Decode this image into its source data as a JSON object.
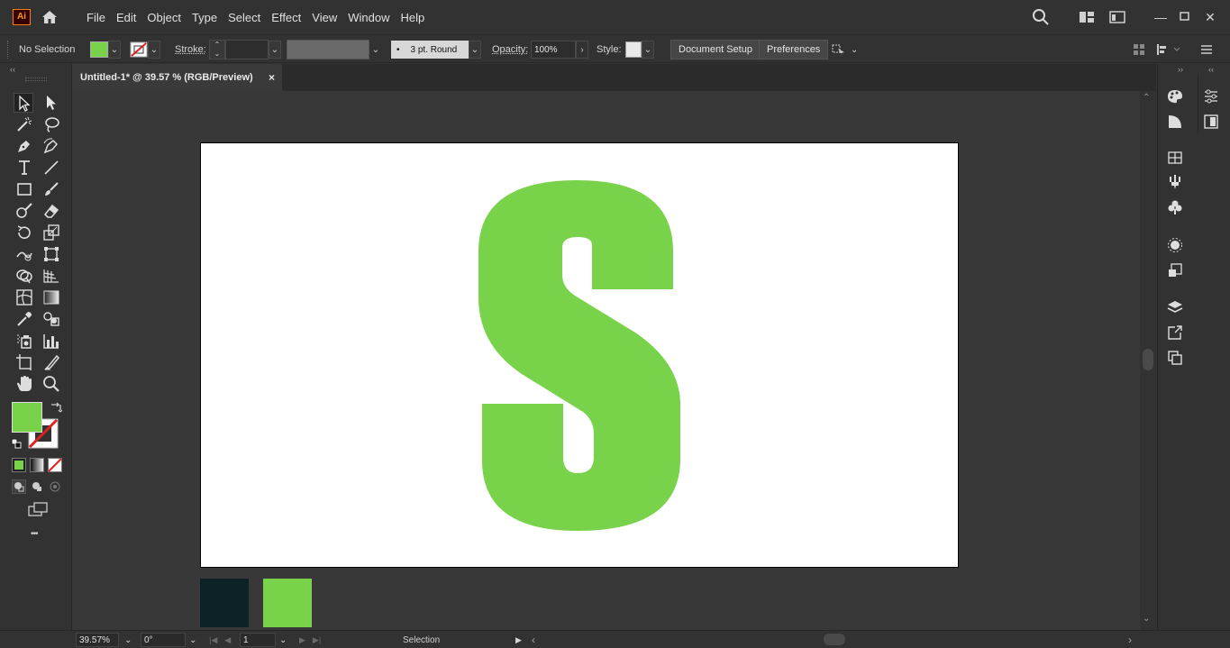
{
  "app": {
    "logo_text": "Ai",
    "brand_color": "#ff9a00"
  },
  "menu": [
    "File",
    "Edit",
    "Object",
    "Type",
    "Select",
    "Effect",
    "View",
    "Window",
    "Help"
  ],
  "control_bar": {
    "selection_status": "No Selection",
    "fill_color": "#78d24a",
    "stroke_label": "Stroke:",
    "stroke_profile": "3 pt. Round",
    "opacity_label": "Opacity:",
    "opacity_value": "100%",
    "style_label": "Style:",
    "document_setup": "Document Setup",
    "preferences": "Preferences"
  },
  "document_tab": {
    "title": "Untitled-1* @ 39.57 % (RGB/Preview)",
    "close": "×"
  },
  "artboard": {
    "shape_color": "#78d24a",
    "swatches": [
      "#0c2225",
      "#78d24a"
    ]
  },
  "statusbar": {
    "zoom": "39.57%",
    "rotation": "0°",
    "artboard_number": "1",
    "tool_name": "Selection"
  },
  "toolbar": {
    "fill": "#78d24a",
    "more": "•••"
  }
}
